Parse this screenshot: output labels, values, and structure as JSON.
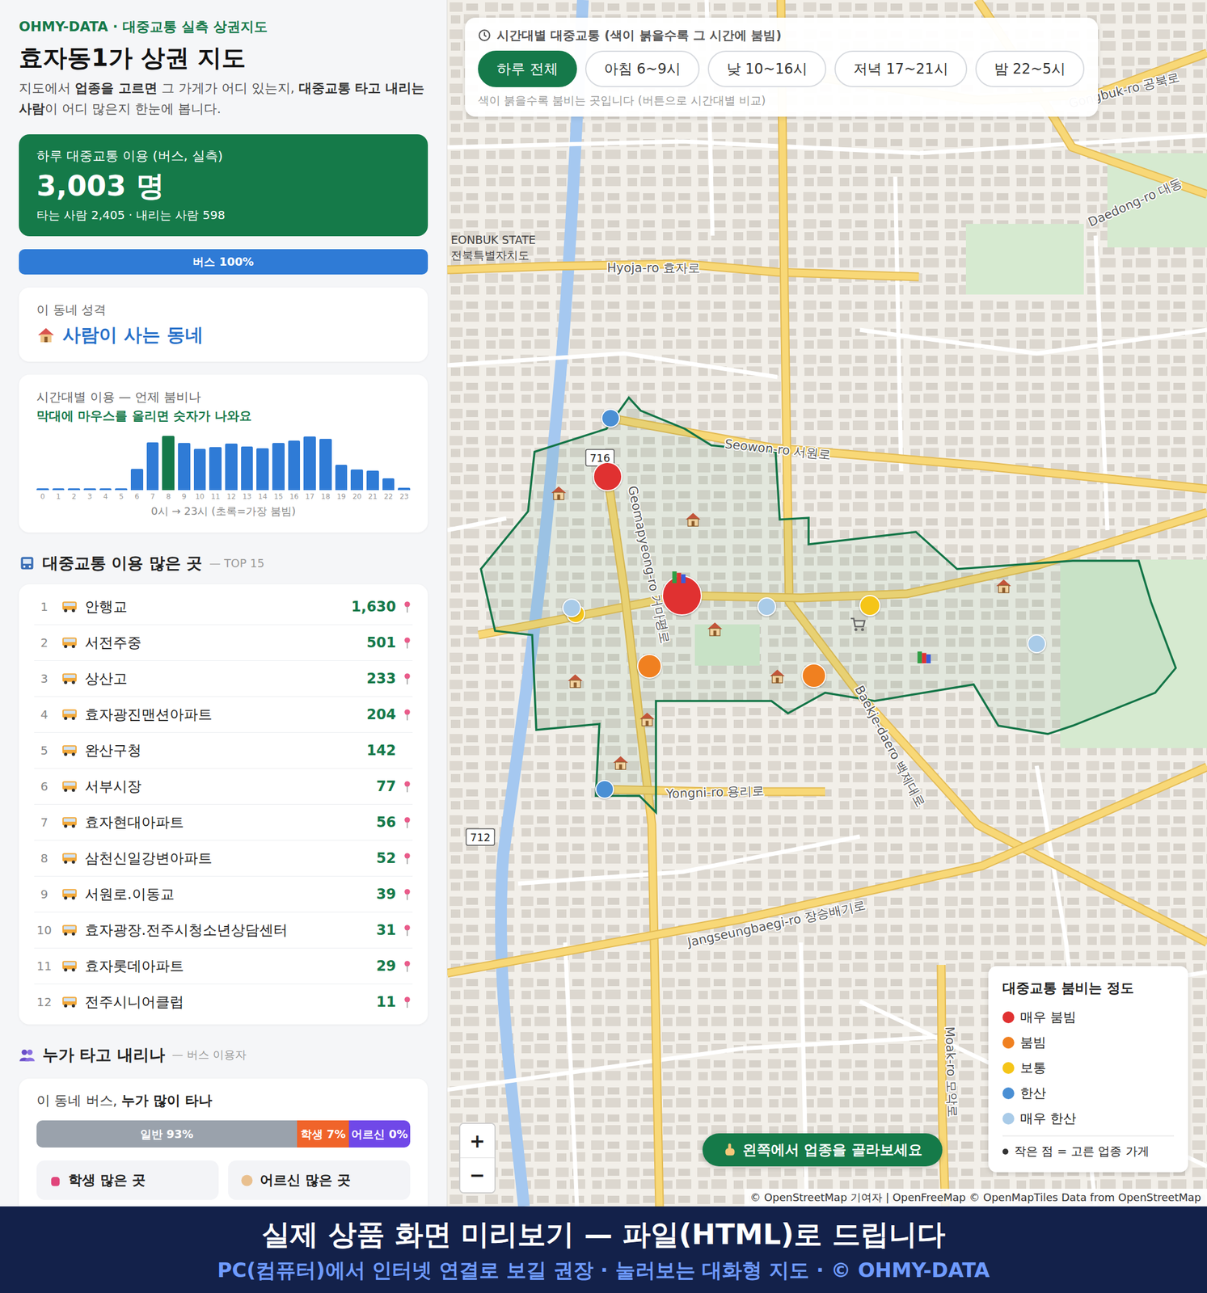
{
  "brand": "OHMY-DATA · 대중교통 실측 상권지도",
  "title": "효자동1가 상권 지도",
  "intro": [
    {
      "text": "지도에서 ",
      "bold": false
    },
    {
      "text": "업종을 고르면",
      "bold": true
    },
    {
      "text": " 그 가게가 어디 있는지, ",
      "bold": false
    },
    {
      "text": "대중교통 타고 내리는 사람",
      "bold": true
    },
    {
      "text": "이 어디 많은지 한눈에 봅니다.",
      "bold": false
    }
  ],
  "summary": {
    "label": "하루 대중교통 이용 (버스, 실측)",
    "value": "3,003 명",
    "detail": "타는 사람 2,405 · 내리는 사람 598"
  },
  "mode_bar": {
    "label": "버스 100%",
    "level": 1
  },
  "character": {
    "label": "이 동네 성격",
    "value": "사람이 사는 동네"
  },
  "hourly": {
    "title": "시간대별 이용 — 언제 붐비나",
    "hint": "막대에 마우스를 올리면 숫자가 나와요",
    "values": [
      5,
      4,
      3,
      3,
      4,
      6,
      93,
      212,
      240,
      209,
      183,
      190,
      205,
      194,
      186,
      209,
      220,
      238,
      227,
      112,
      90,
      86,
      52,
      11
    ],
    "labels": [
      "0",
      "1",
      "2",
      "3",
      "4",
      "5",
      "6",
      "7",
      "8",
      "9",
      "10",
      "11",
      "12",
      "13",
      "14",
      "15",
      "16",
      "17",
      "18",
      "19",
      "20",
      "21",
      "22",
      "23"
    ],
    "caption": "0시 → 23시 (초록=가장 붐빔)"
  },
  "top": {
    "title": "대중교통 이용 많은 곳",
    "sub": "— TOP 15",
    "rows": [
      {
        "rank": "1",
        "name": "안행교",
        "count": "1,630",
        "pin": true
      },
      {
        "rank": "2",
        "name": "서전주중",
        "count": "501",
        "pin": true
      },
      {
        "rank": "3",
        "name": "상산고",
        "count": "233",
        "pin": true
      },
      {
        "rank": "4",
        "name": "효자광진맨션아파트",
        "count": "204",
        "pin": true
      },
      {
        "rank": "5",
        "name": "완산구청",
        "count": "142",
        "pin": false
      },
      {
        "rank": "6",
        "name": "서부시장",
        "count": "77",
        "pin": true
      },
      {
        "rank": "7",
        "name": "효자현대아파트",
        "count": "56",
        "pin": true
      },
      {
        "rank": "8",
        "name": "삼천신일강변아파트",
        "count": "52",
        "pin": true
      },
      {
        "rank": "9",
        "name": "서원로.이동교",
        "count": "39",
        "pin": true
      },
      {
        "rank": "10",
        "name": "효자광장.전주시청소년상담센터",
        "count": "31",
        "pin": true
      },
      {
        "rank": "11",
        "name": "효자롯데아파트",
        "count": "29",
        "pin": true
      },
      {
        "rank": "12",
        "name": "전주시니어클럽",
        "count": "11",
        "pin": true
      }
    ]
  },
  "riders": {
    "title": "누가 타고 내리나",
    "sub": "— 버스 이용자",
    "question_pre": "이 동네 버스, ",
    "question_bold": "누가 많이 타나",
    "segments": [
      {
        "label": "일반 93%",
        "level": 0.93,
        "color": "#9aa2ac"
      },
      {
        "label": "학생 7%",
        "level": 0.07,
        "color": "#f0642a"
      },
      {
        "label": "어르신 0%",
        "level": 0,
        "color": "#7048e8"
      }
    ],
    "cards": [
      "학생 많은 곳",
      "어르신 많은 곳"
    ]
  },
  "time_panel": {
    "title": "시간대별 대중교통 (색이 붉을수록 그 시간에 붐빔)",
    "options": [
      {
        "label": "하루 전체",
        "selected": true
      },
      {
        "label": "아침 6~9시",
        "selected": false
      },
      {
        "label": "낮 10~16시",
        "selected": false
      },
      {
        "label": "저녁 17~21시",
        "selected": false
      },
      {
        "label": "밤 22~5시",
        "selected": false
      }
    ],
    "note": "색이 붉을수록 붐비는 곳입니다 (버튼으로 시간대별 비교)"
  },
  "map": {
    "region_labels": [
      "EONBUK STATE",
      "전북특별자치도"
    ],
    "road_labels": [
      "Hyoja-ro 효자로",
      "Seowon-ro 서원로",
      "Gongbuk-ro 공북로",
      "Daedong-ro 대동",
      "Geomapyeong-ro 거마평로",
      "Baekje-daero 백제대로",
      "Yongni-ro 용리로",
      "Jangseungbaegi-ro 장승배기로",
      "Moak-ro 모악로"
    ],
    "shields": [
      "716",
      "712"
    ],
    "stops": [
      {
        "color": "#e03131"
      },
      {
        "color": "#e03131"
      },
      {
        "color": "#4a8fd4"
      },
      {
        "color": "#f5c518"
      },
      {
        "color": "#a9cbe8"
      },
      {
        "color": "#a9cbe8"
      },
      {
        "color": "#f5c518"
      },
      {
        "color": "#f08020"
      },
      {
        "color": "#f08020"
      },
      {
        "color": "#a9cbe8"
      },
      {
        "color": "#4a8fd4"
      }
    ]
  },
  "legend": {
    "title": "대중교통 붐비는 정도",
    "items": [
      {
        "label": "매우 붐빔",
        "color": "#e03131"
      },
      {
        "label": "붐빔",
        "color": "#f08020"
      },
      {
        "label": "보통",
        "color": "#f5c518"
      },
      {
        "label": "한산",
        "color": "#4a8fd4"
      },
      {
        "label": "매우 한산",
        "color": "#a9cbe8"
      }
    ],
    "note": "작은 점 = 고른 업종 가게"
  },
  "zoom": [
    "+",
    "−"
  ],
  "cta": "왼쪽에서 업종을 골라보세요",
  "attribution": "© OpenStreetMap 기여자 | OpenFreeMap © OpenMapTiles Data from OpenStreetMap",
  "banner": {
    "line1": "실제 상품 화면 미리보기 — 파일(HTML)로 드립니다",
    "line2": "PC(컴퓨터)에서 인터넷 연결로 보길 권장 · 눌러보는 대화형 지도 · © OHMY-DATA"
  }
}
